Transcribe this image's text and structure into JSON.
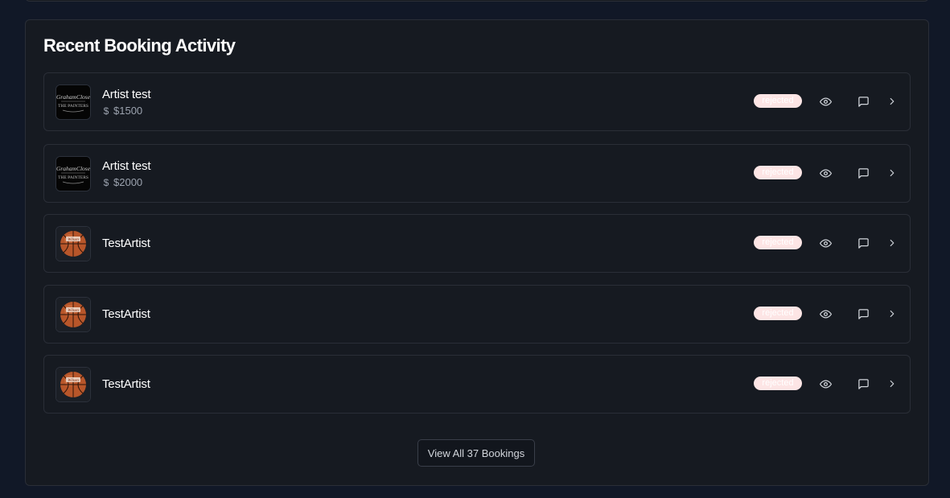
{
  "panel": {
    "title": "Recent Booking Activity"
  },
  "bookings": [
    {
      "artist": "Artist test",
      "avatar_icon": "band-logo-icon",
      "currency_icon": "dollar-icon",
      "currency_symbol": "$",
      "price": "$1500",
      "status": "rejected"
    },
    {
      "artist": "Artist test",
      "avatar_icon": "band-logo-icon",
      "currency_icon": "dollar-icon",
      "currency_symbol": "$",
      "price": "$2000",
      "status": "rejected"
    },
    {
      "artist": "TestArtist",
      "avatar_icon": "basketball-icon",
      "status": "rejected"
    },
    {
      "artist": "TestArtist",
      "avatar_icon": "basketball-icon",
      "status": "rejected"
    },
    {
      "artist": "TestArtist",
      "avatar_icon": "basketball-icon",
      "status": "rejected"
    }
  ],
  "row_actions": {
    "view_icon": "eye-icon",
    "message_icon": "message-square-icon",
    "open_icon": "chevron-right-icon"
  },
  "footer": {
    "view_all_label": "View All 37 Bookings"
  },
  "colors": {
    "background": "#111827",
    "card": "#161a21",
    "border": "#2a2e37",
    "status_rejected_bg": "#fde5e5",
    "muted_text": "#9ca3af"
  }
}
